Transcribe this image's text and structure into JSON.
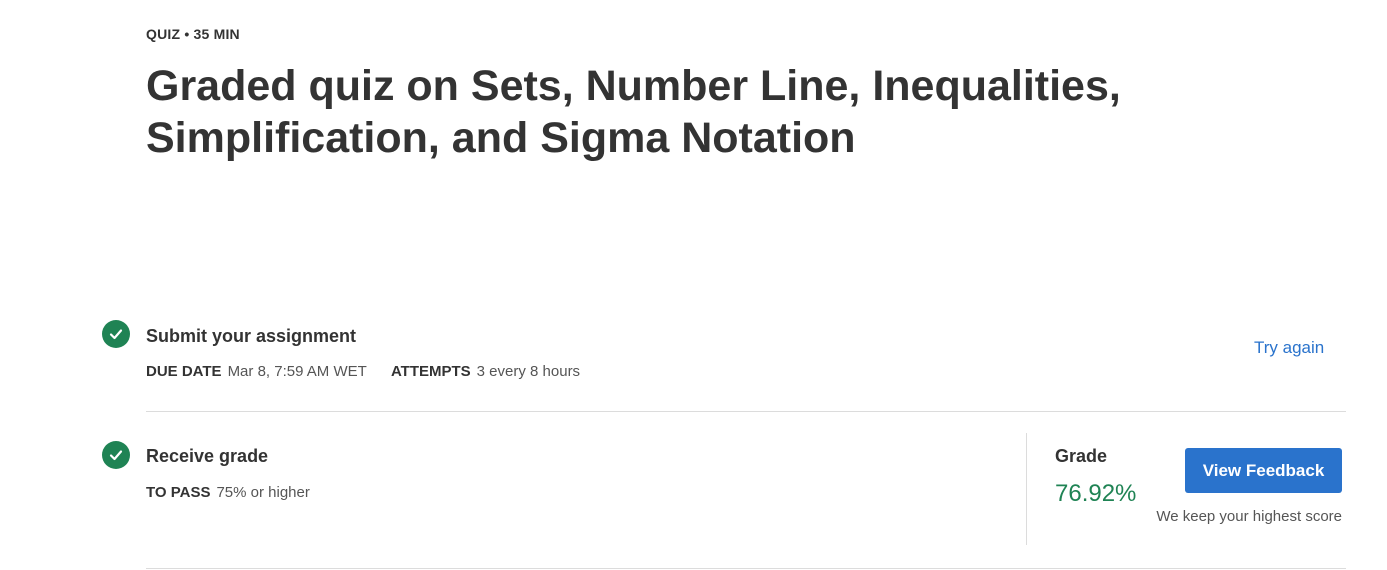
{
  "header": {
    "eyebrow": "QUIZ • 35 MIN",
    "title": "Graded quiz on Sets, Number Line, Inequalities, Simplification, and Sigma Notation"
  },
  "steps": {
    "submit": {
      "heading": "Submit your assignment",
      "due_label": "DUE DATE",
      "due_value": "Mar 8, 7:59 AM WET",
      "attempts_label": "ATTEMPTS",
      "attempts_value": "3 every 8 hours",
      "action_label": "Try again",
      "status_icon": "check-icon"
    },
    "grade": {
      "heading": "Receive grade",
      "pass_label": "TO PASS",
      "pass_value": "75% or higher",
      "grade_label": "Grade",
      "grade_value": "76.92%",
      "button_label": "View Feedback",
      "note": "We keep your highest score",
      "status_icon": "check-icon"
    }
  },
  "colors": {
    "accent": "#2a73cc",
    "success": "#1f8354",
    "text": "#333333"
  }
}
